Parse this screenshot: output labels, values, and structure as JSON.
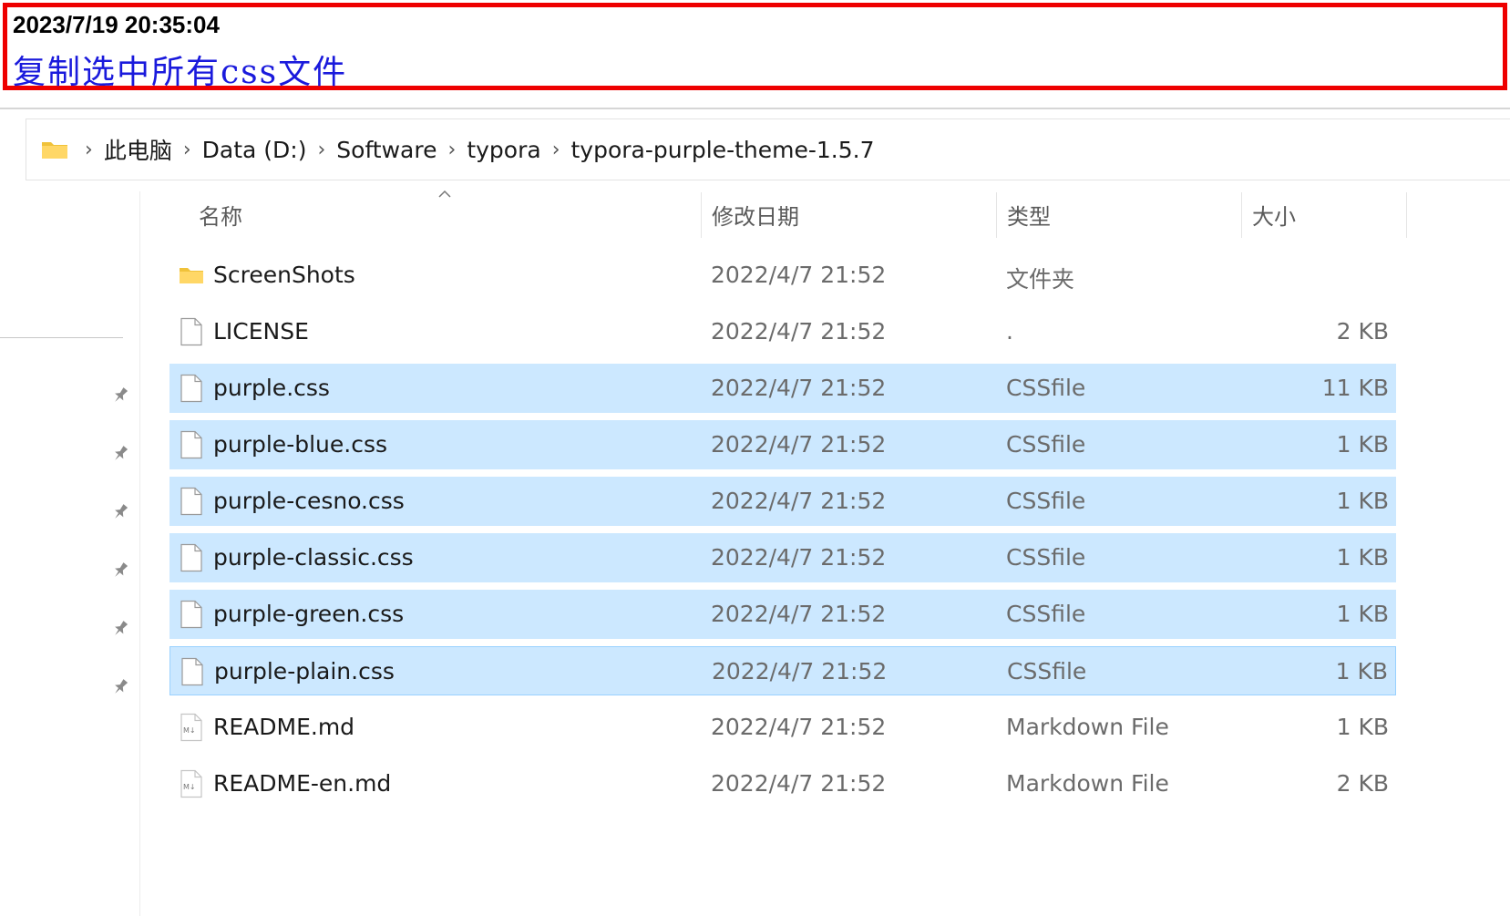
{
  "annotation": {
    "timestamp": "2023/7/19  20:35:04",
    "caption": "复制选中所有css文件"
  },
  "breadcrumb": [
    "此电脑",
    "Data (D:)",
    "Software",
    "typora",
    "typora-purple-theme-1.5.7"
  ],
  "columns": {
    "name": "名称",
    "modified": "修改日期",
    "type": "类型",
    "size": "大小"
  },
  "files": [
    {
      "name": "ScreenShots",
      "modified": "2022/4/7 21:52",
      "type": "文件夹",
      "size": "",
      "icon": "folder-icon",
      "selected": false
    },
    {
      "name": "LICENSE",
      "modified": "2022/4/7 21:52",
      "type": ".",
      "size": "2 KB",
      "icon": "file-icon",
      "selected": false
    },
    {
      "name": "purple.css",
      "modified": "2022/4/7 21:52",
      "type": "CSSfile",
      "size": "11 KB",
      "icon": "file-icon",
      "selected": true
    },
    {
      "name": "purple-blue.css",
      "modified": "2022/4/7 21:52",
      "type": "CSSfile",
      "size": "1 KB",
      "icon": "file-icon",
      "selected": true
    },
    {
      "name": "purple-cesno.css",
      "modified": "2022/4/7 21:52",
      "type": "CSSfile",
      "size": "1 KB",
      "icon": "file-icon",
      "selected": true
    },
    {
      "name": "purple-classic.css",
      "modified": "2022/4/7 21:52",
      "type": "CSSfile",
      "size": "1 KB",
      "icon": "file-icon",
      "selected": true
    },
    {
      "name": "purple-green.css",
      "modified": "2022/4/7 21:52",
      "type": "CSSfile",
      "size": "1 KB",
      "icon": "file-icon",
      "selected": true
    },
    {
      "name": "purple-plain.css",
      "modified": "2022/4/7 21:52",
      "type": "CSSfile",
      "size": "1 KB",
      "icon": "file-icon",
      "selected": true,
      "focused": true
    },
    {
      "name": "README.md",
      "modified": "2022/4/7 21:52",
      "type": "Markdown File",
      "size": "1 KB",
      "icon": "markdown-file-icon",
      "selected": false
    },
    {
      "name": "README-en.md",
      "modified": "2022/4/7 21:52",
      "type": "Markdown File",
      "size": "2 KB",
      "icon": "markdown-file-icon",
      "selected": false
    }
  ],
  "colors": {
    "annotation_border": "#ee0000",
    "caption": "#1a1adc",
    "selection": "#cce8ff",
    "selection_border": "#99d1ff"
  }
}
